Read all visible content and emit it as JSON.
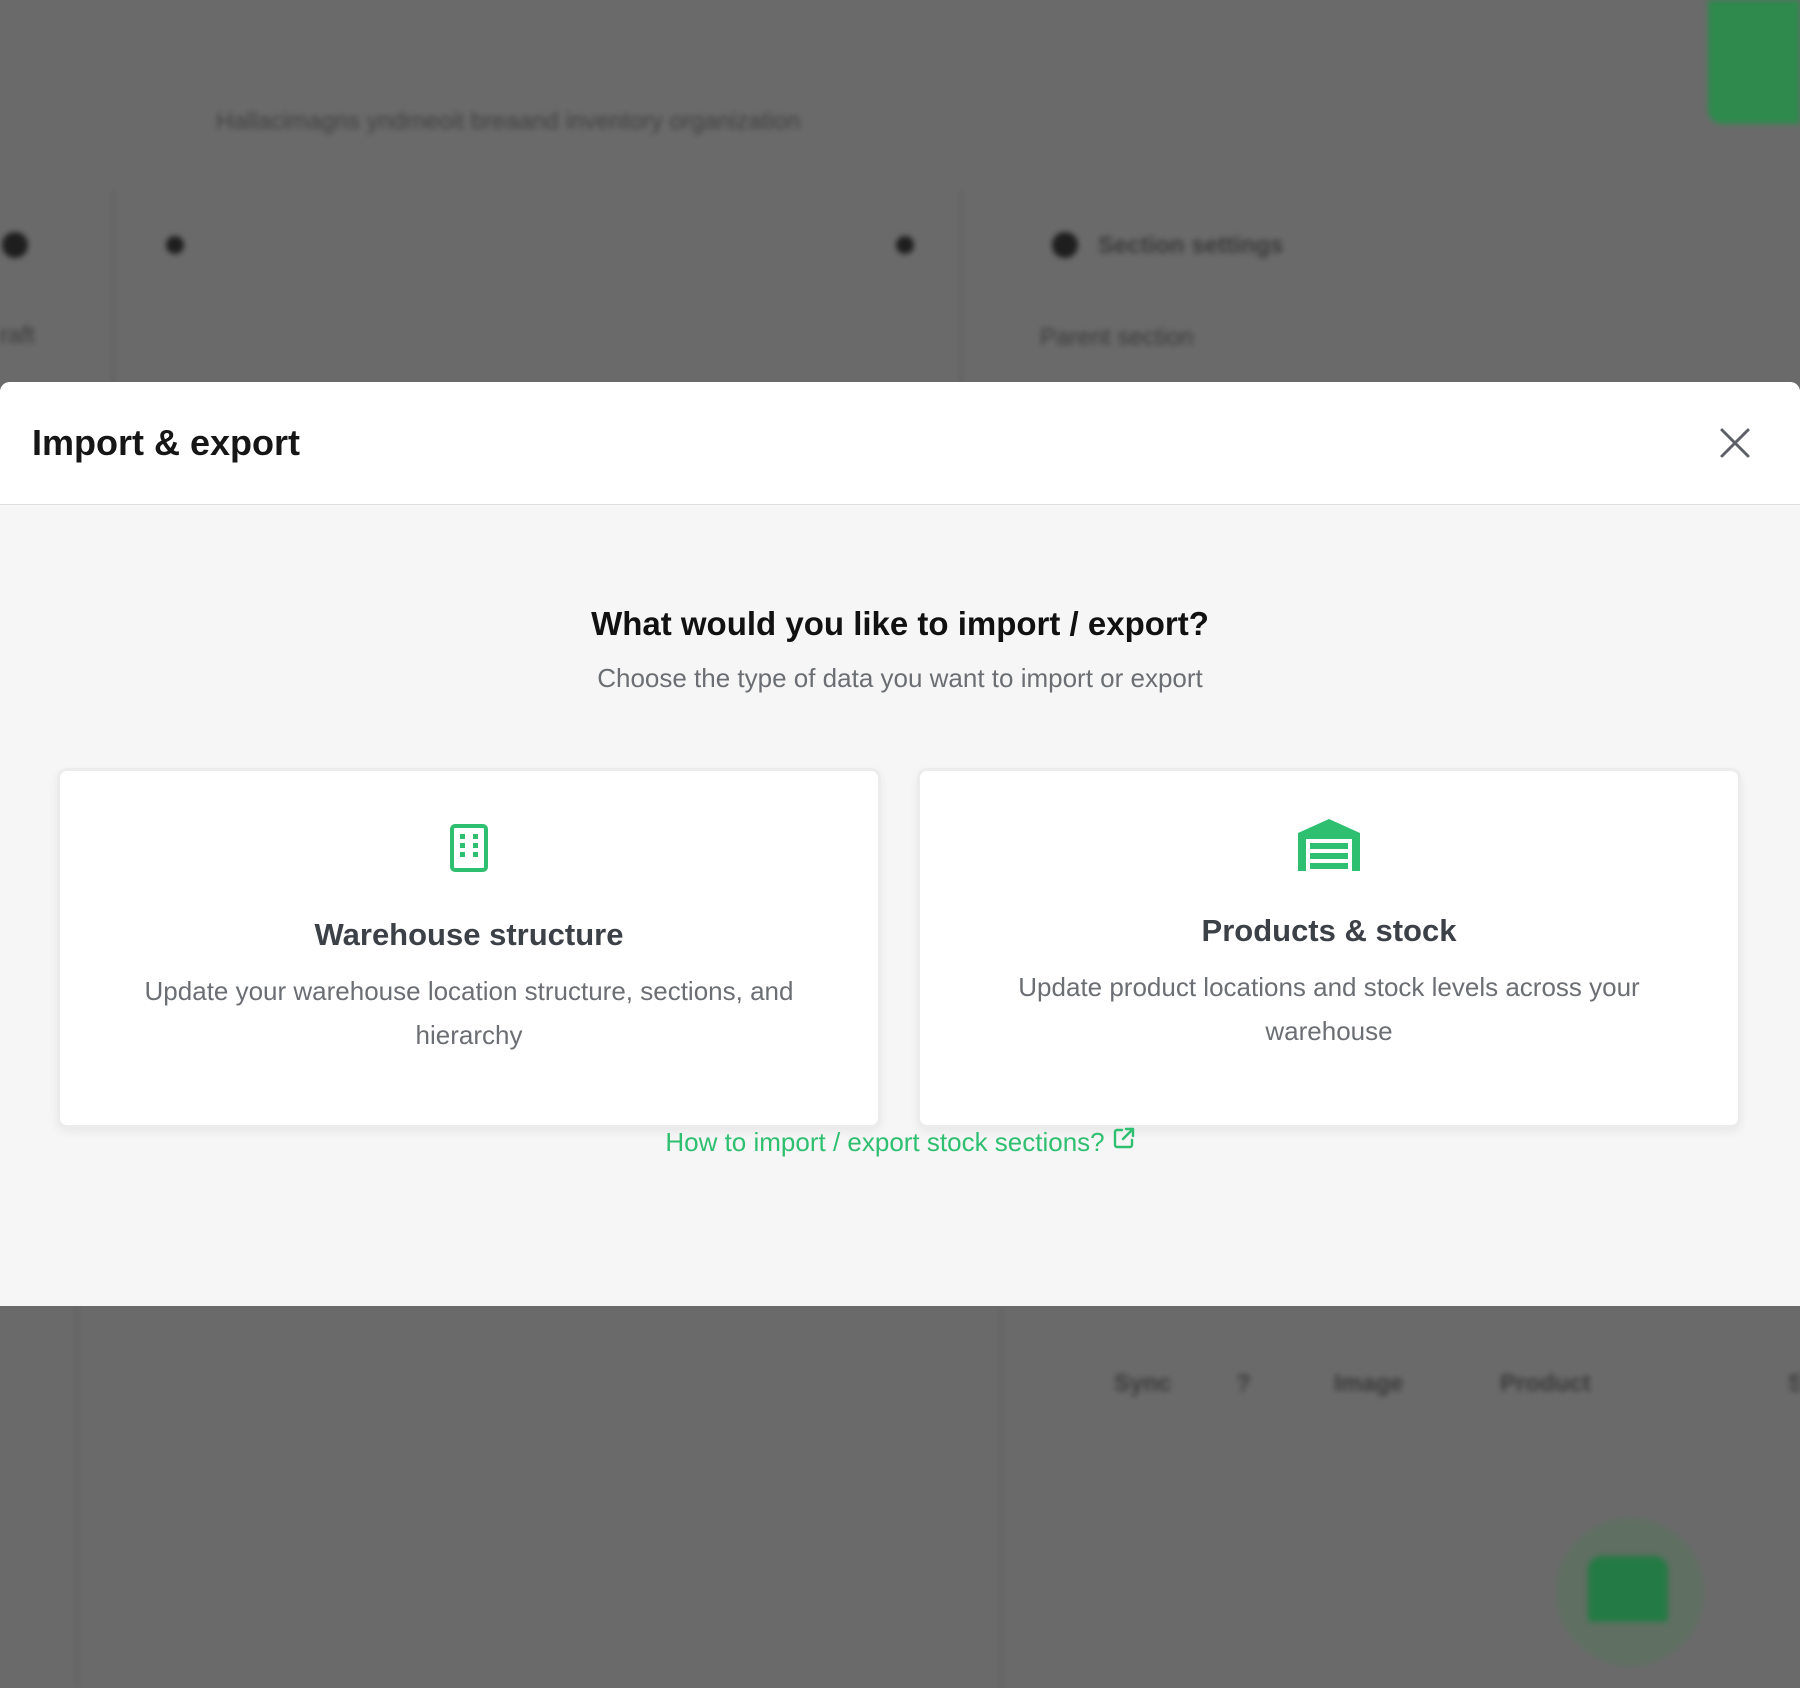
{
  "background": {
    "tagline": "Hallacimagns yndmeoit breaand inventory organization",
    "section_settings": "Section settings",
    "parent_section": "Parent section",
    "left_label": "raft",
    "table_headers": [
      "Sync",
      "?",
      "Image",
      "Product",
      "S"
    ]
  },
  "modal": {
    "title": "Import & export",
    "question": "What would you like to import / export?",
    "subtitle": "Choose the type of data you want to import or export",
    "options": [
      {
        "icon": "building-icon",
        "title": "Warehouse structure",
        "description": "Update your warehouse location structure, sections, and hierarchy"
      },
      {
        "icon": "warehouse-icon",
        "title": "Products & stock",
        "description": "Update product locations and stock levels across your warehouse"
      }
    ],
    "help_link": "How to import / export stock sections?"
  },
  "colors": {
    "accent": "#2fbf71",
    "overlay": "#6a6a6a",
    "modal_body": "#f6f6f6"
  }
}
